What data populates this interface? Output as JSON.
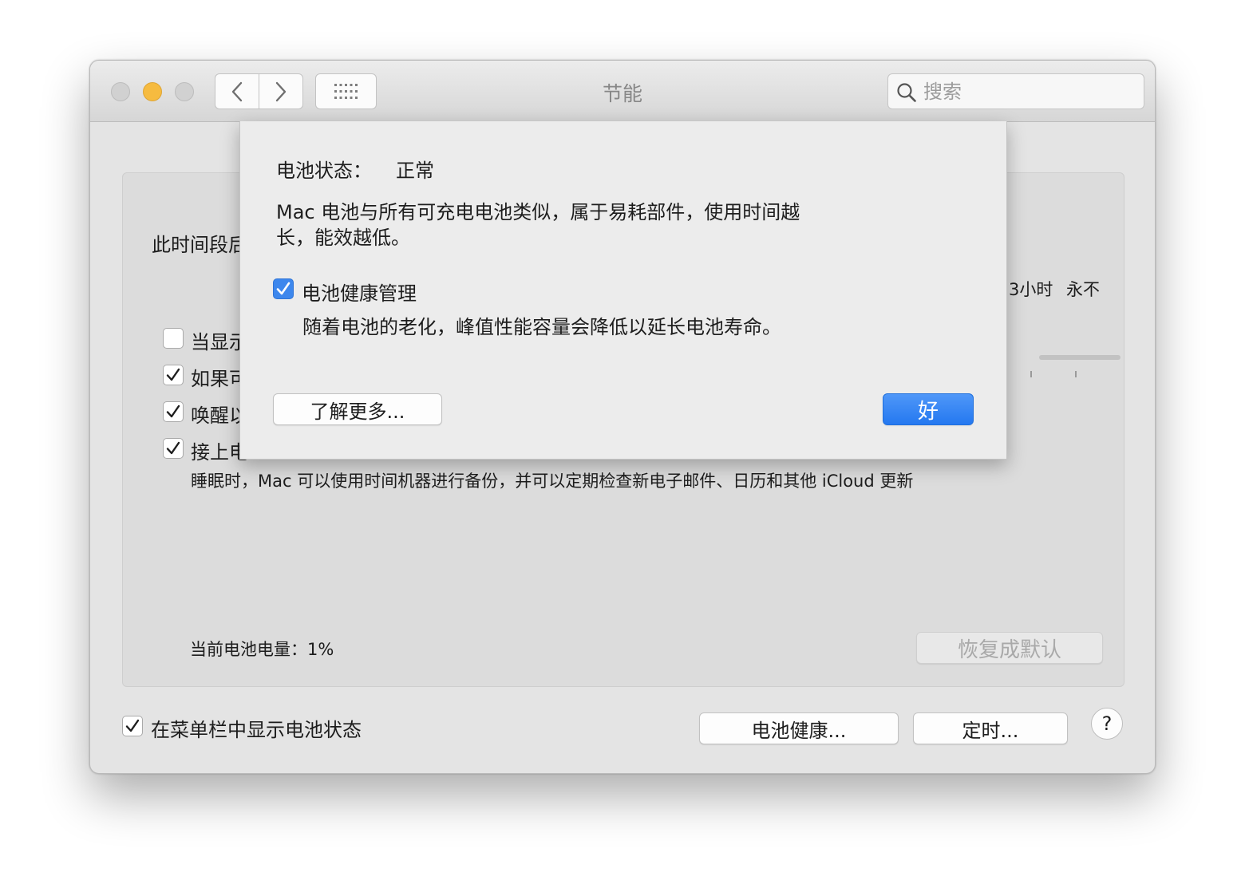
{
  "window": {
    "title": "节能",
    "search_placeholder": "搜索"
  },
  "panel": {
    "period_label": "此时间段后",
    "slider_ticks": [
      "3小时",
      "永不"
    ],
    "options": [
      {
        "label": "当显示",
        "checked": false
      },
      {
        "label": "如果可",
        "checked": true
      },
      {
        "label": "唤醒以",
        "checked": true
      },
      {
        "label": "接上电",
        "checked": true
      }
    ],
    "power_nap_description": "睡眠时，Mac 可以使用时间机器进行备份，并可以定期检查新电子邮件、日历和其他 iCloud 更新",
    "battery_level": "当前电池电量：1%",
    "restore_defaults": "恢复成默认"
  },
  "footer": {
    "show_status_label": "在菜单栏中显示电池状态",
    "show_status_checked": true,
    "battery_health_button": "电池健康...",
    "schedule_button": "定时...",
    "help_button": "?"
  },
  "sheet": {
    "status_label": "电池状态：",
    "status_value": "正常",
    "description_line1": "Mac 电池与所有可充电电池类似，属于易耗部件，使用时间越",
    "description_line2": "长，能效越低。",
    "management_label": "电池健康管理",
    "management_checked": true,
    "management_description": "随着电池的老化，峰值性能容量会降低以延长电池寿命。",
    "learn_more": "了解更多...",
    "ok": "好"
  },
  "colors": {
    "accent": "#3d87ed",
    "minimize": "#f6bb40"
  }
}
